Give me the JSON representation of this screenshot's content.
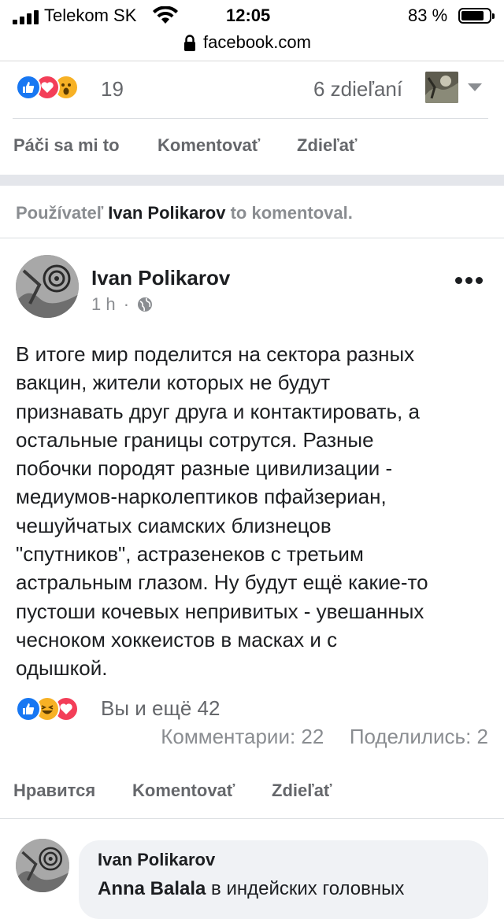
{
  "status_bar": {
    "carrier": "Telekom SK",
    "time": "12:05",
    "battery": "83 %",
    "battery_level": 0.83
  },
  "browser": {
    "url": "facebook.com"
  },
  "prev_post": {
    "reaction_count": "19",
    "shares": "6 zdieľaní",
    "actions": {
      "like": "Páči sa mi to",
      "comment": "Komentovať",
      "share": "Zdieľať"
    }
  },
  "activity": {
    "prefix": "Používateľ",
    "user": "Ivan Polikarov",
    "suffix": "to komentoval."
  },
  "post": {
    "author": "Ivan Polikarov",
    "time": "1 h",
    "lines": [
      "В итоге мир поделится на сектора разных",
      "вакцин, жители которых не будут",
      "признавать друг друга и контактировать, а",
      "остальные границы сотрутся. Разные",
      "побочки породят разные цивилизации -",
      "медиумов-нарколептиков пфайзериан,",
      "чешуйчатых сиамских близнецов",
      "\"спутников\", астразенеков с третьим",
      "астральным глазом. Ну будут ещё какие-то",
      "пустоши кочевых непривитых - увешанных",
      "чесноком хоккеистов в масках и с",
      "одышкой."
    ],
    "reactions_text": "Вы и ещё 42",
    "comments": "Комментарии: 22",
    "shares": "Поделились: 2",
    "actions": {
      "like": "Нравится",
      "comment": "Komentovať",
      "share": "Zdieľať"
    }
  },
  "comment": {
    "author": "Ivan Polikarov",
    "mention": "Anna Balala",
    "text": " в индейских головных"
  },
  "colors": {
    "facebook_blue": "#1877f2",
    "love_red": "#f33e58",
    "reaction_yellow": "#f7b125",
    "secondary_text": "#65676b"
  }
}
